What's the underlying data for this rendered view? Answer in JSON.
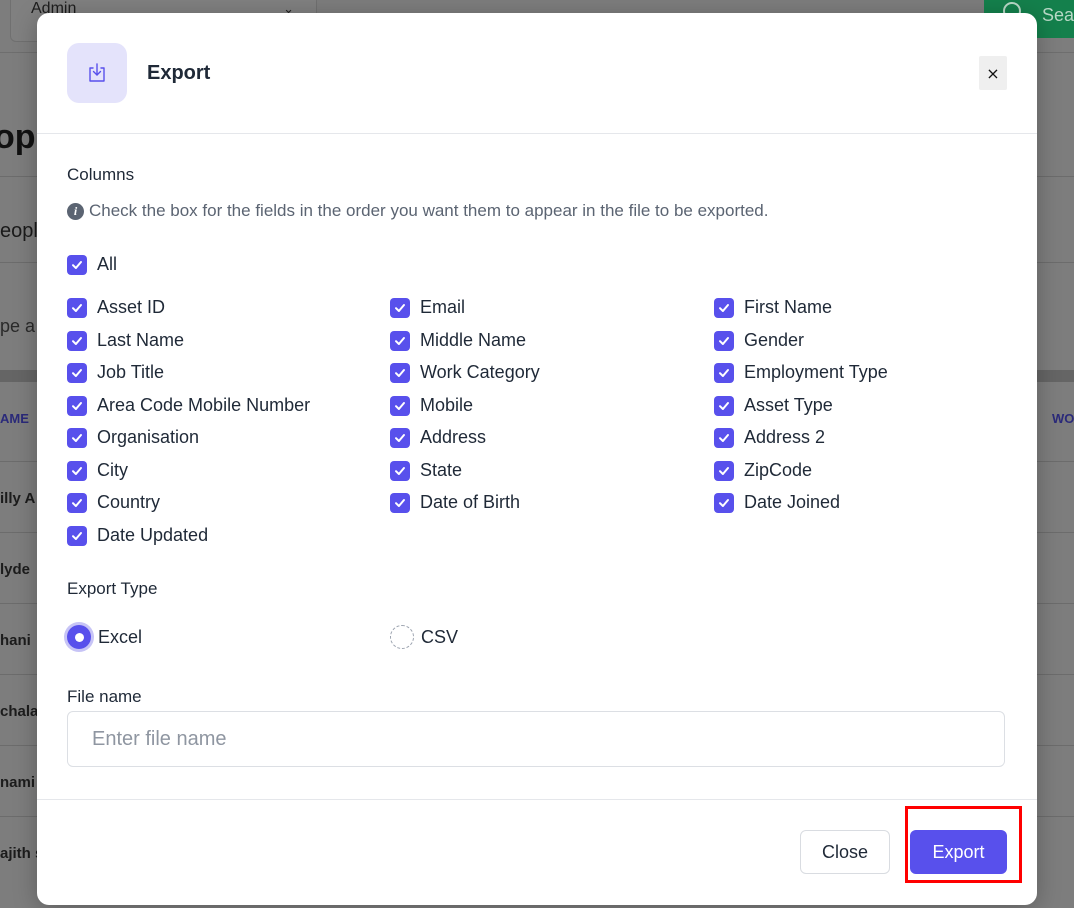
{
  "background": {
    "select_label": "Admin",
    "search_label": "Sea",
    "heading": "op",
    "tab_label": "eople",
    "input_text": "pe a",
    "col_name": "AME",
    "col_wo": "WO",
    "rows": [
      "illy A",
      "lyde",
      "hani",
      "chala",
      "nami",
      "ajith s"
    ]
  },
  "modal": {
    "title": "Export",
    "header_icon": "download-icon",
    "close_symbol": "×",
    "columns_label": "Columns",
    "hint": "Check the box for the fields in the order you want them to appear in the file to be exported.",
    "all_label": "All",
    "columns": [
      [
        "Asset ID",
        "Email",
        "First Name"
      ],
      [
        "Last Name",
        "Middle Name",
        "Gender"
      ],
      [
        "Job Title",
        "Work Category",
        "Employment Type"
      ],
      [
        "Area Code Mobile Number",
        "Mobile",
        "Asset Type"
      ],
      [
        "Organisation",
        "Address",
        "Address 2"
      ],
      [
        "City",
        "State",
        "ZipCode"
      ],
      [
        "Country",
        "Date of Birth",
        "Date Joined"
      ],
      [
        "Date Updated"
      ]
    ],
    "export_type_label": "Export Type",
    "export_types": [
      "Excel",
      "CSV"
    ],
    "selected_export_type": "Excel",
    "file_name_label": "File name",
    "file_name_placeholder": "Enter file name",
    "file_name_value": "",
    "close_button": "Close",
    "export_button": "Export"
  },
  "colors": {
    "accent": "#5850ec",
    "accent_light": "#e4e3fb",
    "highlight": "#ff0000"
  }
}
